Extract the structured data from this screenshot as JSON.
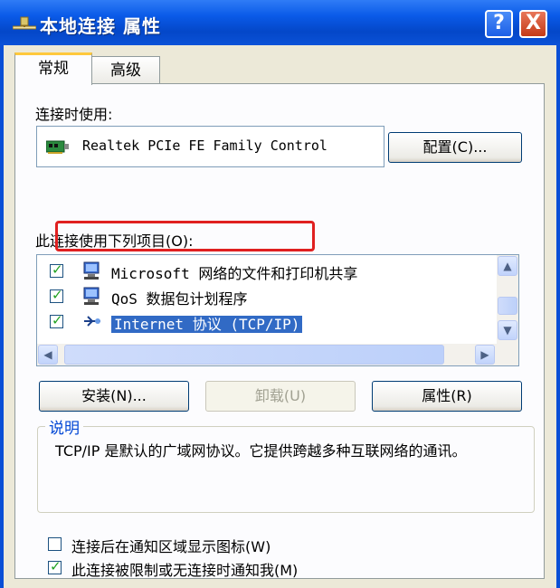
{
  "window": {
    "title": "本地连接 属性",
    "help_label": "?",
    "close_label": "X"
  },
  "tabs": [
    {
      "label": "常规",
      "active": true
    },
    {
      "label": "高级",
      "active": false
    }
  ],
  "connect_using": {
    "label": "连接时使用:",
    "adapter": "Realtek PCIe FE Family Control",
    "configure_button": "配置(C)..."
  },
  "components": {
    "label": "此连接使用下列项目(O):",
    "items": [
      {
        "label": "Microsoft 网络的文件和打印机共享",
        "checked": true,
        "icon": "network-service-icon",
        "selected": false
      },
      {
        "label": "QoS 数据包计划程序",
        "checked": true,
        "icon": "network-service-icon",
        "selected": false
      },
      {
        "label": "Internet 协议 (TCP/IP)",
        "checked": true,
        "icon": "protocol-icon",
        "selected": true
      }
    ],
    "highlight_color": "#e02020",
    "selection_color": "#316ac5"
  },
  "buttons": {
    "install": "安装(N)...",
    "uninstall": "卸载(U)",
    "properties": "属性(R)"
  },
  "description": {
    "label": "说明",
    "text": "TCP/IP 是默认的广域网协议。它提供跨越多种互联网络的通讯。"
  },
  "options": [
    {
      "label": "连接后在通知区域显示图标(W)",
      "checked": false
    },
    {
      "label": "此连接被限制或无连接时通知我(M)",
      "checked": true
    }
  ],
  "colors": {
    "titlebar": "#0a5ae8",
    "dialog_bg": "#ece9d8",
    "tab_accent": "#ffc83c"
  }
}
